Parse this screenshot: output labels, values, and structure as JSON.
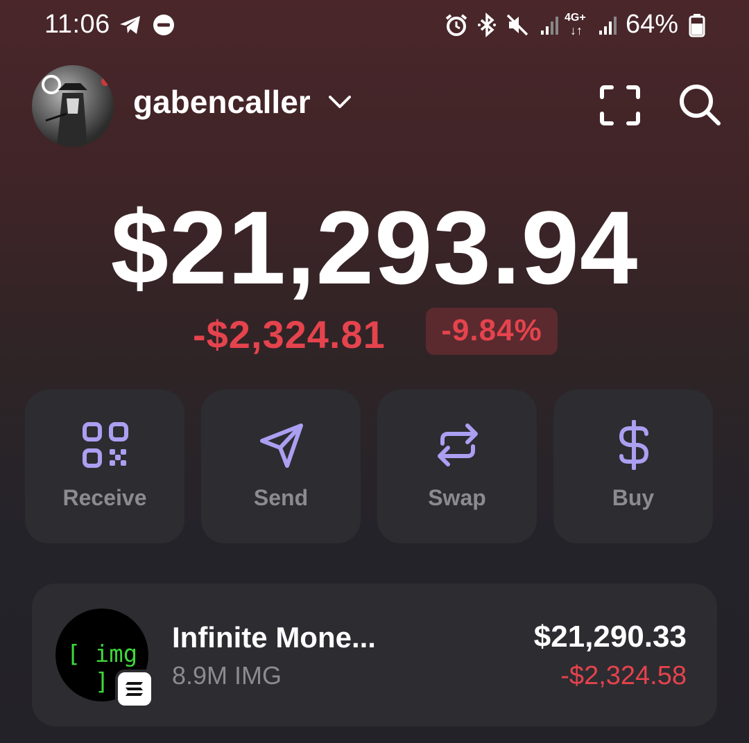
{
  "status_bar": {
    "time": "11:06",
    "network": "4G+",
    "battery": "64%",
    "icons": [
      "telegram-icon",
      "do-not-disturb-icon",
      "alarm-icon",
      "bluetooth-icon",
      "mute-icon",
      "signal-icon",
      "battery-icon"
    ]
  },
  "header": {
    "account_name": "gabencaller",
    "icons": [
      "avatar",
      "chevron-down-icon",
      "scan-icon",
      "search-icon"
    ]
  },
  "balance": {
    "total": "$21,293.94",
    "change_amount": "-$2,324.81",
    "change_percent": "-9.84%"
  },
  "actions": [
    {
      "label": "Receive",
      "icon": "qr-code-icon"
    },
    {
      "label": "Send",
      "icon": "send-icon"
    },
    {
      "label": "Swap",
      "icon": "swap-icon"
    },
    {
      "label": "Buy",
      "icon": "dollar-icon"
    }
  ],
  "tokens": [
    {
      "name": "Infinite Mone...",
      "amount": "8.9M IMG",
      "value": "$21,290.33",
      "change": "-$2,324.58",
      "logo_text": "[ img ]",
      "chain_icon": "solana-icon"
    }
  ],
  "colors": {
    "background_top": "#4a262a",
    "background_bottom": "#232228",
    "card": "#2d2c31",
    "negative": "#e5434d",
    "accent": "#ab9ff2",
    "muted_text": "#8c8b90"
  }
}
